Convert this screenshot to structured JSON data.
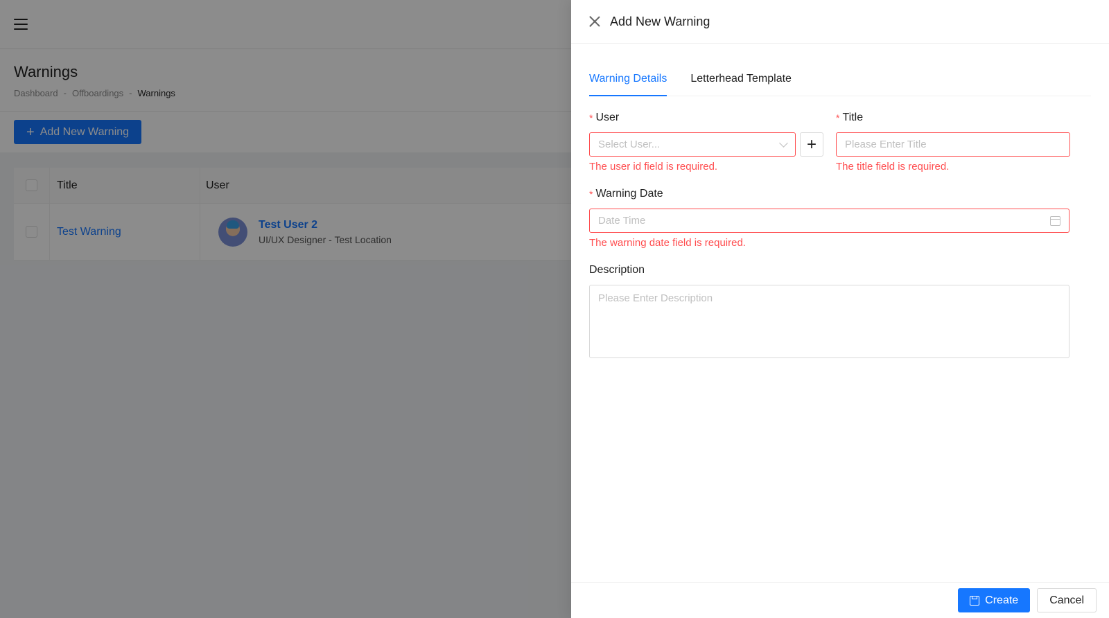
{
  "page": {
    "title": "Warnings",
    "breadcrumb": [
      "Dashboard",
      "Offboardings",
      "Warnings"
    ],
    "breadcrumb_separator": "-",
    "add_button_label": "Add New Warning",
    "table": {
      "columns": [
        "Title",
        "User"
      ],
      "rows": [
        {
          "title": "Test Warning",
          "user_name": "Test User 2",
          "user_sub": "UI/UX Designer - Test Location"
        }
      ]
    }
  },
  "drawer": {
    "title": "Add New Warning",
    "tabs": [
      "Warning Details",
      "Letterhead Template"
    ],
    "fields": {
      "user": {
        "label": "User",
        "placeholder": "Select User...",
        "error": "The user id field is required."
      },
      "title": {
        "label": "Title",
        "placeholder": "Please Enter Title",
        "error": "The title field is required."
      },
      "warning_date": {
        "label": "Warning Date",
        "placeholder": "Date Time",
        "error": "The warning date field is required."
      },
      "description": {
        "label": "Description",
        "placeholder": "Please Enter Description"
      }
    },
    "create_label": "Create",
    "cancel_label": "Cancel"
  },
  "colors": {
    "accent": "#1677ff",
    "error": "#ff4d4f"
  }
}
